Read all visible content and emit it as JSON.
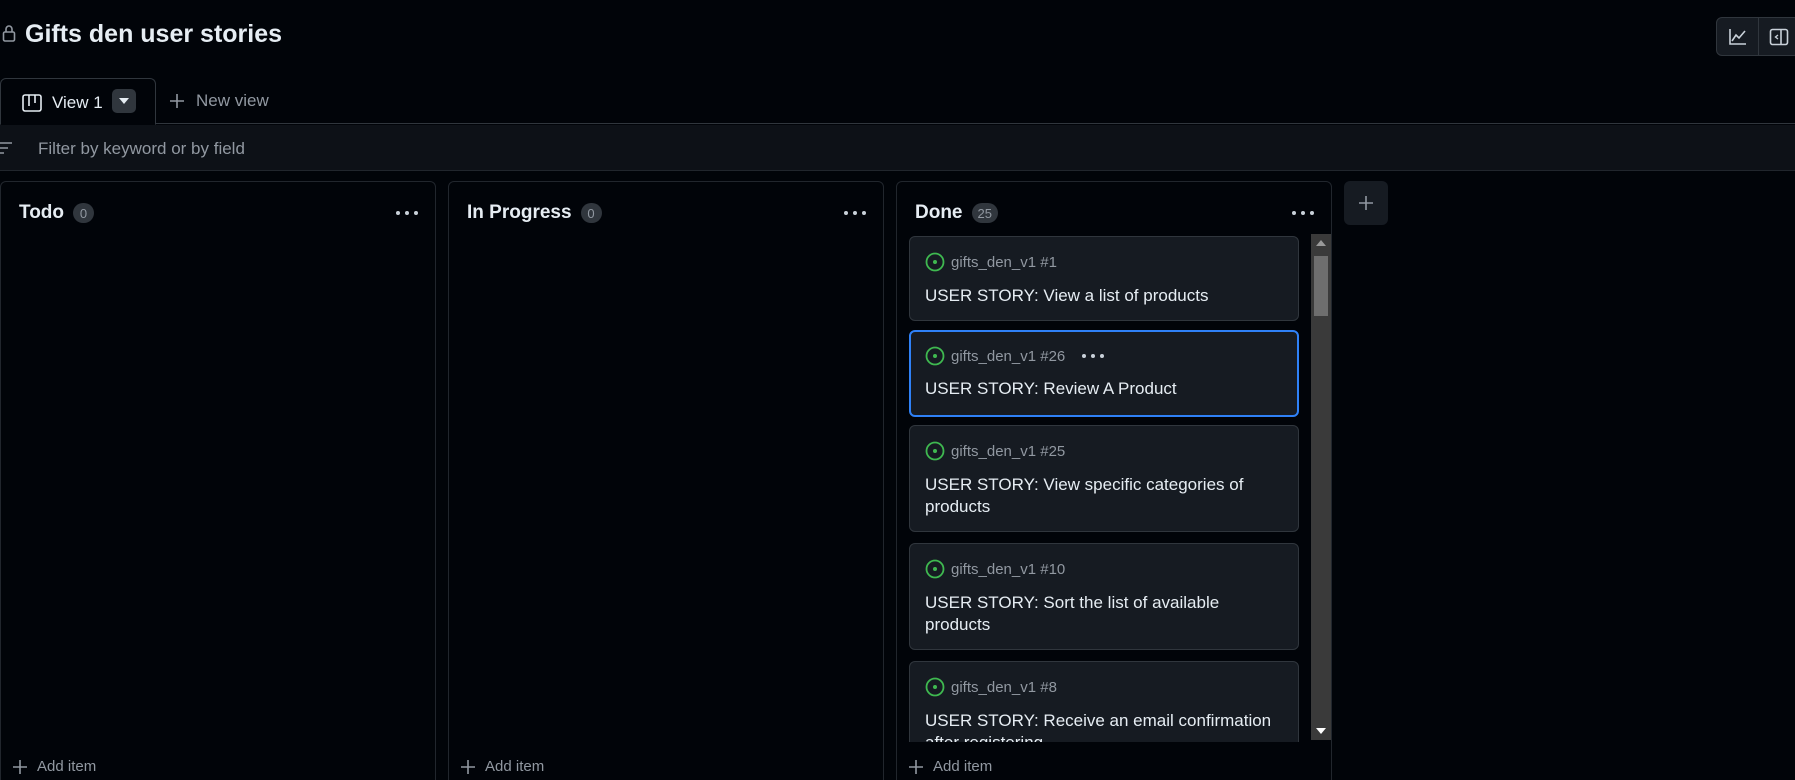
{
  "header": {
    "title": "Gifts den user stories",
    "icons": [
      "lock-icon",
      "insights-icon",
      "side-panel-icon"
    ]
  },
  "tabs": {
    "view1_label": "View 1",
    "new_view_label": "New view"
  },
  "filter": {
    "placeholder": "Filter by keyword or by field"
  },
  "columns": [
    {
      "title": "Todo",
      "count": "0",
      "add_label": "Add item"
    },
    {
      "title": "In Progress",
      "count": "0",
      "add_label": "Add item"
    },
    {
      "title": "Done",
      "count": "25",
      "add_label": "Add item"
    }
  ],
  "cards": [
    {
      "ref": "gifts_den_v1 #1",
      "title": "USER STORY: View a list of products"
    },
    {
      "ref": "gifts_den_v1 #26",
      "title": "USER STORY: Review A Product"
    },
    {
      "ref": "gifts_den_v1 #25",
      "title": "USER STORY: View specific categories of products"
    },
    {
      "ref": "gifts_den_v1 #10",
      "title": "USER STORY: Sort the list of available products"
    },
    {
      "ref": "gifts_den_v1 #8",
      "title": "USER STORY: Receive an email confirmation after registering"
    }
  ],
  "colors": {
    "background": "#010409",
    "card": "#161b22",
    "open_issue": "#3fb950",
    "selection": "#2f81f7"
  }
}
